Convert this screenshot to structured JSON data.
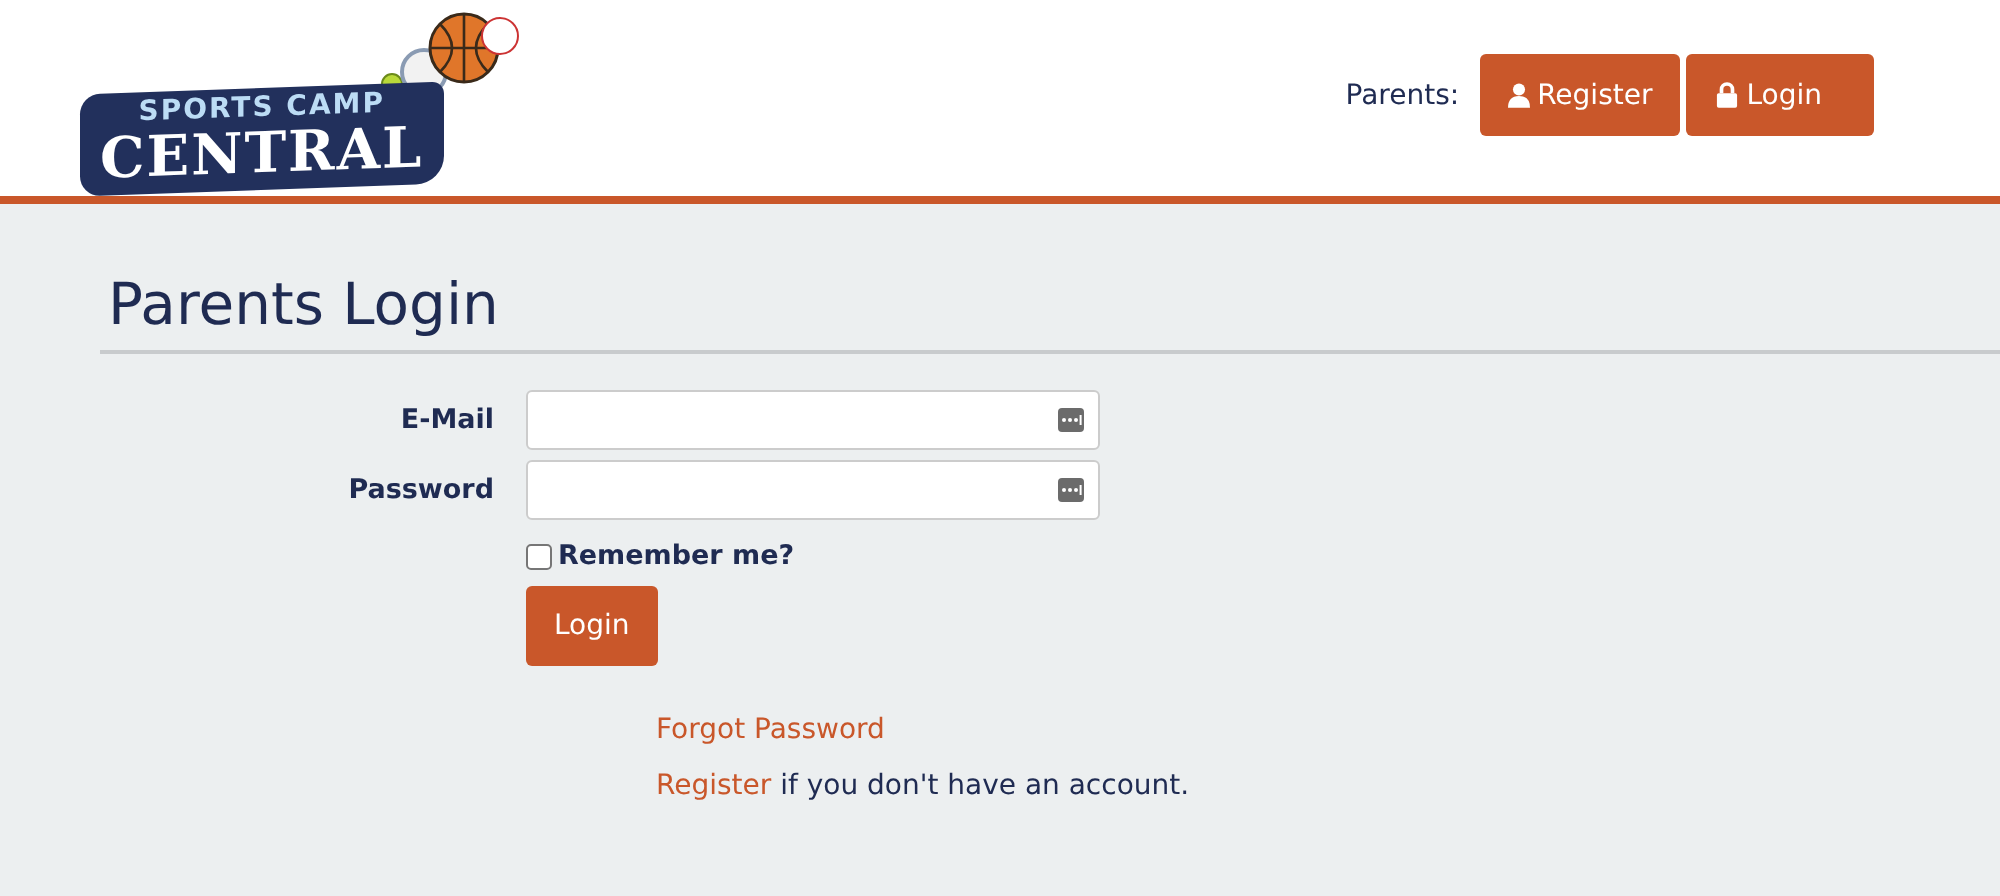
{
  "header": {
    "logo": {
      "top_line": "SPORTS CAMP",
      "bottom_line": "CENTRAL"
    },
    "account_label": "Parents:",
    "buttons": [
      {
        "label": "Register"
      },
      {
        "label": "Login"
      }
    ]
  },
  "page_title": "Parents Login",
  "form": {
    "fields": [
      {
        "label": "E-Mail"
      },
      {
        "label": "Password"
      }
    ],
    "remember": {
      "label": "Remember me?",
      "checked": false
    },
    "submit": "Login"
  },
  "links": {
    "forgot": "Forgot Password",
    "register_link": "Register",
    "register_rest": " if you don't have an account."
  }
}
